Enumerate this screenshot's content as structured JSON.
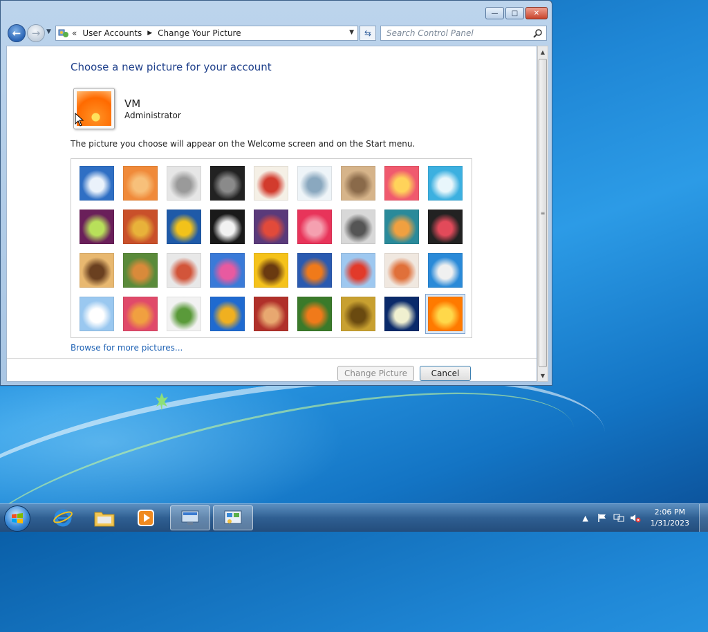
{
  "window": {
    "address": {
      "overflow_glyph": "«",
      "crumbs": [
        "User Accounts",
        "Change Your Picture"
      ]
    },
    "search_placeholder": "Search Control Panel"
  },
  "page": {
    "heading": "Choose a new picture for your account",
    "user_name": "VM",
    "user_role": "Administrator",
    "description": "The picture you choose will appear on the Welcome screen and on the Start menu.",
    "browse_link": "Browse for more pictures...",
    "change_button": "Change Picture",
    "cancel_button": "Cancel"
  },
  "pictures": [
    {
      "name": "roller-coaster",
      "colors": [
        "#2f6fc4",
        "#eaf2fb"
      ]
    },
    {
      "name": "starfish",
      "colors": [
        "#f08a3a",
        "#f7c07a"
      ]
    },
    {
      "name": "robot-figure",
      "colors": [
        "#e6e6e6",
        "#9a9a9a"
      ]
    },
    {
      "name": "turntable",
      "colors": [
        "#222222",
        "#8a8a8a"
      ]
    },
    {
      "name": "lucky-cat",
      "colors": [
        "#f5f0e6",
        "#d23b2d"
      ]
    },
    {
      "name": "gyroscope",
      "colors": [
        "#eef4f8",
        "#8aa8bf"
      ]
    },
    {
      "name": "kitten",
      "colors": [
        "#d6b48a",
        "#8a6a4a"
      ]
    },
    {
      "name": "pink-flower",
      "colors": [
        "#f05a6e",
        "#ffd35a"
      ]
    },
    {
      "name": "pinwheel",
      "colors": [
        "#3cb0e0",
        "#e8f6fb"
      ]
    },
    {
      "name": "ball",
      "colors": [
        "#6a1f5a",
        "#b8e05a"
      ]
    },
    {
      "name": "fabric-stripes",
      "colors": [
        "#c9502a",
        "#e8b23a"
      ]
    },
    {
      "name": "ginkgo-leaf",
      "colors": [
        "#1f5aa8",
        "#f2c21a"
      ]
    },
    {
      "name": "dog-collie",
      "colors": [
        "#1a1a1a",
        "#f2f2f2"
      ]
    },
    {
      "name": "crayons",
      "colors": [
        "#5a3a7a",
        "#e24a3a"
      ]
    },
    {
      "name": "paper-star",
      "colors": [
        "#e8345a",
        "#f5a0b0"
      ]
    },
    {
      "name": "jacks",
      "colors": [
        "#d8d8d8",
        "#555555"
      ]
    },
    {
      "name": "stairs",
      "colors": [
        "#2a8a9a",
        "#f0a040"
      ]
    },
    {
      "name": "origami-crane",
      "colors": [
        "#222222",
        "#e24a5a"
      ]
    },
    {
      "name": "guitar",
      "colors": [
        "#e8b870",
        "#6a4020"
      ]
    },
    {
      "name": "pomeranian",
      "colors": [
        "#5a8a3a",
        "#d98a3a"
      ]
    },
    {
      "name": "toy-robot",
      "colors": [
        "#e8e8e8",
        "#d2553a"
      ]
    },
    {
      "name": "feathers",
      "colors": [
        "#3a7ad8",
        "#e85aa0"
      ]
    },
    {
      "name": "sunflower",
      "colors": [
        "#f5c21a",
        "#6a3a10"
      ]
    },
    {
      "name": "fish",
      "colors": [
        "#2a5ab0",
        "#f07a1a"
      ]
    },
    {
      "name": "hot-air-balloon",
      "colors": [
        "#9ec8f0",
        "#e23a2a"
      ]
    },
    {
      "name": "doll",
      "colors": [
        "#f0e8e0",
        "#e0703a"
      ]
    },
    {
      "name": "sailboat",
      "colors": [
        "#2a8ad8",
        "#f0f0f0"
      ]
    },
    {
      "name": "soccer-ball",
      "colors": [
        "#9ac8f0",
        "#ffffff"
      ]
    },
    {
      "name": "fabric-pink",
      "colors": [
        "#e04a6a",
        "#f0a040"
      ]
    },
    {
      "name": "marbles",
      "colors": [
        "#f2f2f2",
        "#5a9a3a"
      ]
    },
    {
      "name": "window-frame",
      "colors": [
        "#1f6ad0",
        "#f0b020"
      ]
    },
    {
      "name": "woven-rug",
      "colors": [
        "#b0302a",
        "#e8a870"
      ]
    },
    {
      "name": "butterfly",
      "colors": [
        "#3a7a2a",
        "#f07a1a"
      ]
    },
    {
      "name": "basket-weave",
      "colors": [
        "#c8a030",
        "#6a4a10"
      ]
    },
    {
      "name": "lighthouse",
      "colors": [
        "#0a2a6a",
        "#f0f0d0"
      ]
    },
    {
      "name": "orange-flower",
      "colors": [
        "#ff7a00",
        "#ffd84a"
      ]
    }
  ],
  "selected_picture": "orange-flower",
  "taskbar": {
    "clock_time": "2:06 PM",
    "clock_date": "1/31/2023",
    "items": [
      {
        "name": "internet-explorer",
        "active": false
      },
      {
        "name": "file-explorer",
        "active": false
      },
      {
        "name": "media-player",
        "active": false
      },
      {
        "name": "remote-desktop",
        "active": true
      },
      {
        "name": "control-panel",
        "active": true
      }
    ]
  }
}
